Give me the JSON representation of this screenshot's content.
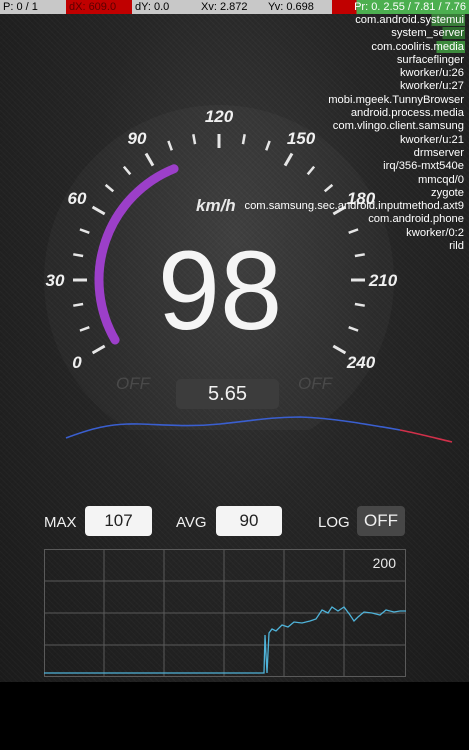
{
  "pointer_bar": {
    "p": "P: 0 / 1",
    "dx": "dX: 609.0",
    "dy": "dY: 0.0",
    "xv": "Xv: 2.872",
    "yv": "Yv: 0.698",
    "pr": "Pr: 0.  2.55 / 7.81 / 7.76"
  },
  "processes": [
    "com.android.systemui",
    "system_server",
    "com.cooliris.media",
    "surfaceflinger",
    "kworker/u:26",
    "kworker/u:27",
    "mobi.mgeek.TunnyBrowser",
    "android.process.media",
    "com.vlingo.client.samsung",
    "kworker/u:21",
    "drmserver",
    "irq/356-mxt540e",
    "mmcqd/0",
    "zygote",
    "com.samsung.sec.android.inputmethod.axt9",
    "com.android.phone",
    "kworker/0:2",
    "rild"
  ],
  "speedometer": {
    "tick_labels": [
      "0",
      "30",
      "60",
      "90",
      "120",
      "150",
      "180",
      "210",
      "240"
    ],
    "unit": "km/h",
    "speed": "98",
    "speed_value": 98,
    "max_scale": 240,
    "arc_color": "#9c3fc9",
    "left_toggle": "OFF",
    "right_toggle": "OFF",
    "distance": "5.65"
  },
  "stats": {
    "max_label": "MAX",
    "max_value": "107",
    "avg_label": "AVG",
    "avg_value": "90",
    "log_label": "LOG",
    "log_state": "OFF"
  },
  "graph": {
    "top_label": "200",
    "line_color": "#4fb3d9"
  },
  "colors": {
    "trend_line": "#3a5fd0",
    "trend_tail": "#d0304a"
  }
}
